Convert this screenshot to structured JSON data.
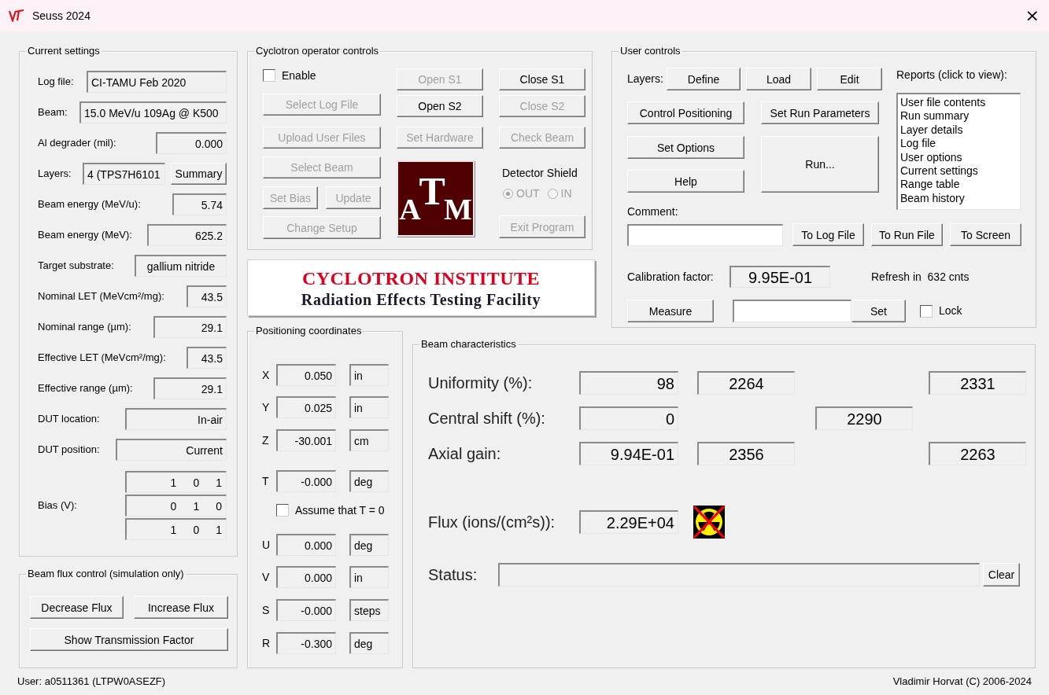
{
  "window": {
    "title": "Seuss 2024",
    "close": "×"
  },
  "current_settings": {
    "title": "Current settings",
    "rows": [
      {
        "kind": "field",
        "label": "Log file:",
        "value": "CI-TAMU Feb 2020"
      },
      {
        "kind": "field",
        "label": "Beam:",
        "value": "15.0 MeV/u 109Ag @ K500"
      },
      {
        "kind": "field",
        "label": "Al degrader (mil):",
        "value": "0.000"
      },
      {
        "kind": "field_button",
        "label": "Layers:",
        "value": "4 (TPS7H6101",
        "button": "Summary"
      },
      {
        "kind": "field",
        "label": "Beam energy (MeV/u):",
        "value": "5.74"
      },
      {
        "kind": "field",
        "label": "Beam energy (MeV):",
        "value": "625.2"
      },
      {
        "kind": "field",
        "label": "Target substrate:",
        "value": "gallium nitride"
      },
      {
        "kind": "field",
        "label": "Nominal LET (MeVcm²/mg):",
        "value": "43.5"
      },
      {
        "kind": "field",
        "label": "Nominal range (µm):",
        "value": "29.1"
      },
      {
        "kind": "field",
        "label": "Effective LET (MeVcm²/mg):",
        "value": "43.5"
      },
      {
        "kind": "field",
        "label": "Effective range (µm):",
        "value": "29.1"
      },
      {
        "kind": "field",
        "label": "DUT location:",
        "value": "In-air"
      },
      {
        "kind": "field",
        "label": "DUT position:",
        "value": "Current"
      },
      {
        "kind": "bias",
        "label": "Bias (V):",
        "values": [
          [
            "1",
            "0",
            "1"
          ],
          [
            "0",
            "1",
            "0"
          ],
          [
            "1",
            "0",
            "1"
          ]
        ]
      }
    ]
  },
  "beam_flux_control": {
    "title": "Beam flux control (simulation only)",
    "buttons": [
      "Decrease Flux",
      "Increase Flux",
      "Show Transmission Factor"
    ]
  },
  "operator_controls": {
    "title": "Cyclotron operator controls",
    "enable": {
      "label": "Enable",
      "checked": false
    },
    "left_buttons": [
      {
        "label": "Select Log File",
        "disabled": true
      },
      {
        "label": "Upload User Files",
        "disabled": true
      },
      {
        "label": "Select Beam",
        "disabled": true
      },
      {
        "label": "Set Bias",
        "disabled": true
      },
      {
        "label": "Update",
        "disabled": true
      },
      {
        "label": "Change Setup",
        "disabled": true
      }
    ],
    "middle_buttons": [
      {
        "label": "Open S1",
        "disabled": true
      },
      {
        "label": "Open S2",
        "disabled": false
      },
      {
        "label": "Set Hardware",
        "disabled": true
      }
    ],
    "right_buttons": [
      {
        "label": "Close S1",
        "disabled": false
      },
      {
        "label": "Close S2",
        "disabled": true
      },
      {
        "label": "Check Beam",
        "disabled": true
      }
    ],
    "logo": {
      "letters": [
        "A",
        "T",
        "M"
      ]
    },
    "detector_shield": {
      "label": "Detector Shield",
      "disabled": true,
      "options": [
        {
          "label": "OUT",
          "selected": true
        },
        {
          "label": "IN",
          "selected": false
        }
      ]
    },
    "exit_button": {
      "label": "Exit Program",
      "disabled": true
    }
  },
  "banner": {
    "line1": "CYCLOTRON INSTITUTE",
    "line2": "Radiation Effects Testing Facility"
  },
  "user_controls": {
    "title": "User controls",
    "layers_label": "Layers:",
    "layer_buttons": [
      "Define",
      "Load",
      "Edit"
    ],
    "buttons": [
      "Control Positioning",
      "Set Run Parameters",
      "Set Options",
      "Run...",
      "Help"
    ],
    "reports_label": "Reports (click to view):",
    "reports": [
      {
        "label": "User file contents",
        "selected": false
      },
      {
        "label": "Run summary",
        "selected": false
      },
      {
        "label": "Layer details",
        "selected": false
      },
      {
        "label": "Log file",
        "selected": false
      },
      {
        "label": "User options",
        "selected": false
      },
      {
        "label": "Current settings",
        "selected": false
      },
      {
        "label": "Range table",
        "selected": false
      },
      {
        "label": "Beam history",
        "selected": false
      }
    ],
    "comment_label": "Comment:",
    "comment_buttons": [
      "To Log File",
      "To Run File",
      "To Screen"
    ],
    "calibration_label": "Calibration factor:",
    "calibration_value": "9.95E-01",
    "refresh": "Refresh in  632 cnts",
    "measure_button": "Measure",
    "set_button": "Set",
    "lock": {
      "label": "Lock",
      "checked": false
    }
  },
  "positioning": {
    "title": "Positioning coordinates",
    "rows": [
      {
        "kind": "coord",
        "label": "X",
        "value": "0.050",
        "unit": "in"
      },
      {
        "kind": "coord",
        "label": "Y",
        "value": "0.025",
        "unit": "in"
      },
      {
        "kind": "coord",
        "label": "Z",
        "value": "-30.001",
        "unit": "cm"
      },
      {
        "kind": "coord",
        "label": "T",
        "value": "-0.000",
        "unit": "deg"
      },
      {
        "kind": "checkbox",
        "label": "Assume that T = 0",
        "checked": false
      },
      {
        "kind": "coord",
        "label": "U",
        "value": "0.000",
        "unit": "deg"
      },
      {
        "kind": "coord",
        "label": "V",
        "value": "0.000",
        "unit": "in"
      },
      {
        "kind": "coord",
        "label": "S",
        "value": "-0.000",
        "unit": "steps"
      },
      {
        "kind": "coord",
        "label": "R",
        "value": "-0.300",
        "unit": "deg"
      }
    ]
  },
  "beam_characteristics": {
    "title": "Beam characteristics",
    "rows": [
      {
        "label": "Uniformity (%):",
        "column_1": "98",
        "column_2": "2264",
        "column_4": "2331"
      },
      {
        "label": "Central shift (%):",
        "column_1": "0",
        "column_3": "2290"
      },
      {
        "label": "Axial gain:",
        "column_1": "9.94E-01",
        "column_2": "2356",
        "column_4": "2263"
      }
    ],
    "flux": {
      "label": "Flux (ions/(cm²s)):",
      "value": "2.29E+04",
      "beam_on": false
    },
    "status": {
      "label": "Status:",
      "clear_button": "Clear"
    }
  },
  "status_bar": {
    "user": "User: a0511361 (LTPW0ASEZF)",
    "copyright": "Vladimir Horvat (C) 2006-2024"
  }
}
